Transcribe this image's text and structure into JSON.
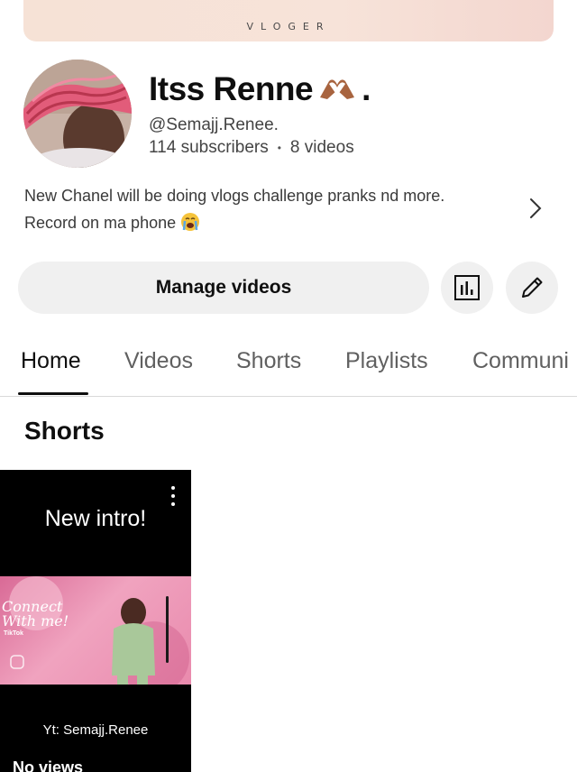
{
  "banner": {
    "text": "VLOGER"
  },
  "channel": {
    "name": "Itss Renne",
    "name_suffix": ".",
    "handle": "@Semajj.Renee.",
    "subscribers": "114 subscribers",
    "separator": "•",
    "videos": "8 videos",
    "description_line1": "New Chanel will be doing vlogs challenge pranks nd more.",
    "description_line2": "Record on ma phone"
  },
  "actions": {
    "manage_label": "Manage videos",
    "analytics_icon": "analytics-icon",
    "edit_icon": "pencil-icon"
  },
  "tabs": [
    {
      "label": "Home",
      "active": true
    },
    {
      "label": "Videos",
      "active": false
    },
    {
      "label": "Shorts",
      "active": false
    },
    {
      "label": "Playlists",
      "active": false
    },
    {
      "label": "Communi",
      "active": false
    }
  ],
  "sections": {
    "shorts_title": "Shorts"
  },
  "shorts": [
    {
      "title": "New intro!",
      "caption": "Yt: Semajj.Renee",
      "views": "No views",
      "overlay_script": "Connect With me!",
      "overlay_brand": "TikTok"
    }
  ],
  "colors": {
    "banner": "#f6e2d6",
    "button_bg": "#f0f0f0",
    "text_primary": "#0f0f0f",
    "text_secondary": "#606060"
  }
}
